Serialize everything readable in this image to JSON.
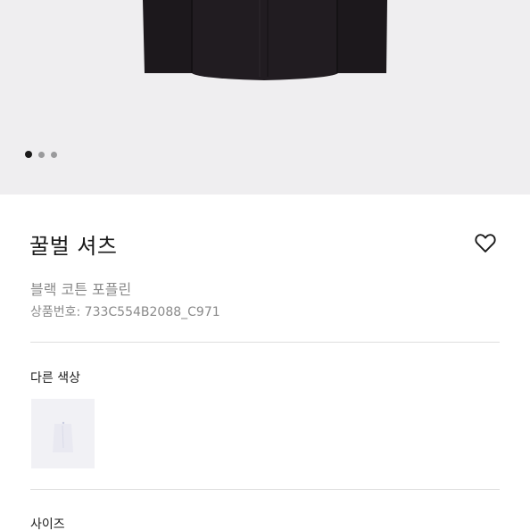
{
  "product": {
    "name": "꿀벌 셔츠",
    "subtitle": "블랙 코튼 포플린",
    "product_number": "상품번호: 733C554B2088_C971"
  },
  "gallery": {
    "image_icon": "shirt-image",
    "active_index": 1,
    "total_images": 3
  },
  "wishlist": {
    "icon": "heart-icon"
  },
  "other_colors": {
    "label": "다른 색상",
    "swatches": [
      {
        "icon": "white-shirt-thumbnail",
        "color": "#f1f1f5"
      }
    ]
  },
  "size": {
    "label": "사이즈"
  },
  "colors": {
    "gallery_bg": "#efeef0",
    "shirt": "#1c181c",
    "text_primary": "#1a1a1a",
    "text_secondary": "#8a8a8a",
    "divider": "#dedede"
  }
}
